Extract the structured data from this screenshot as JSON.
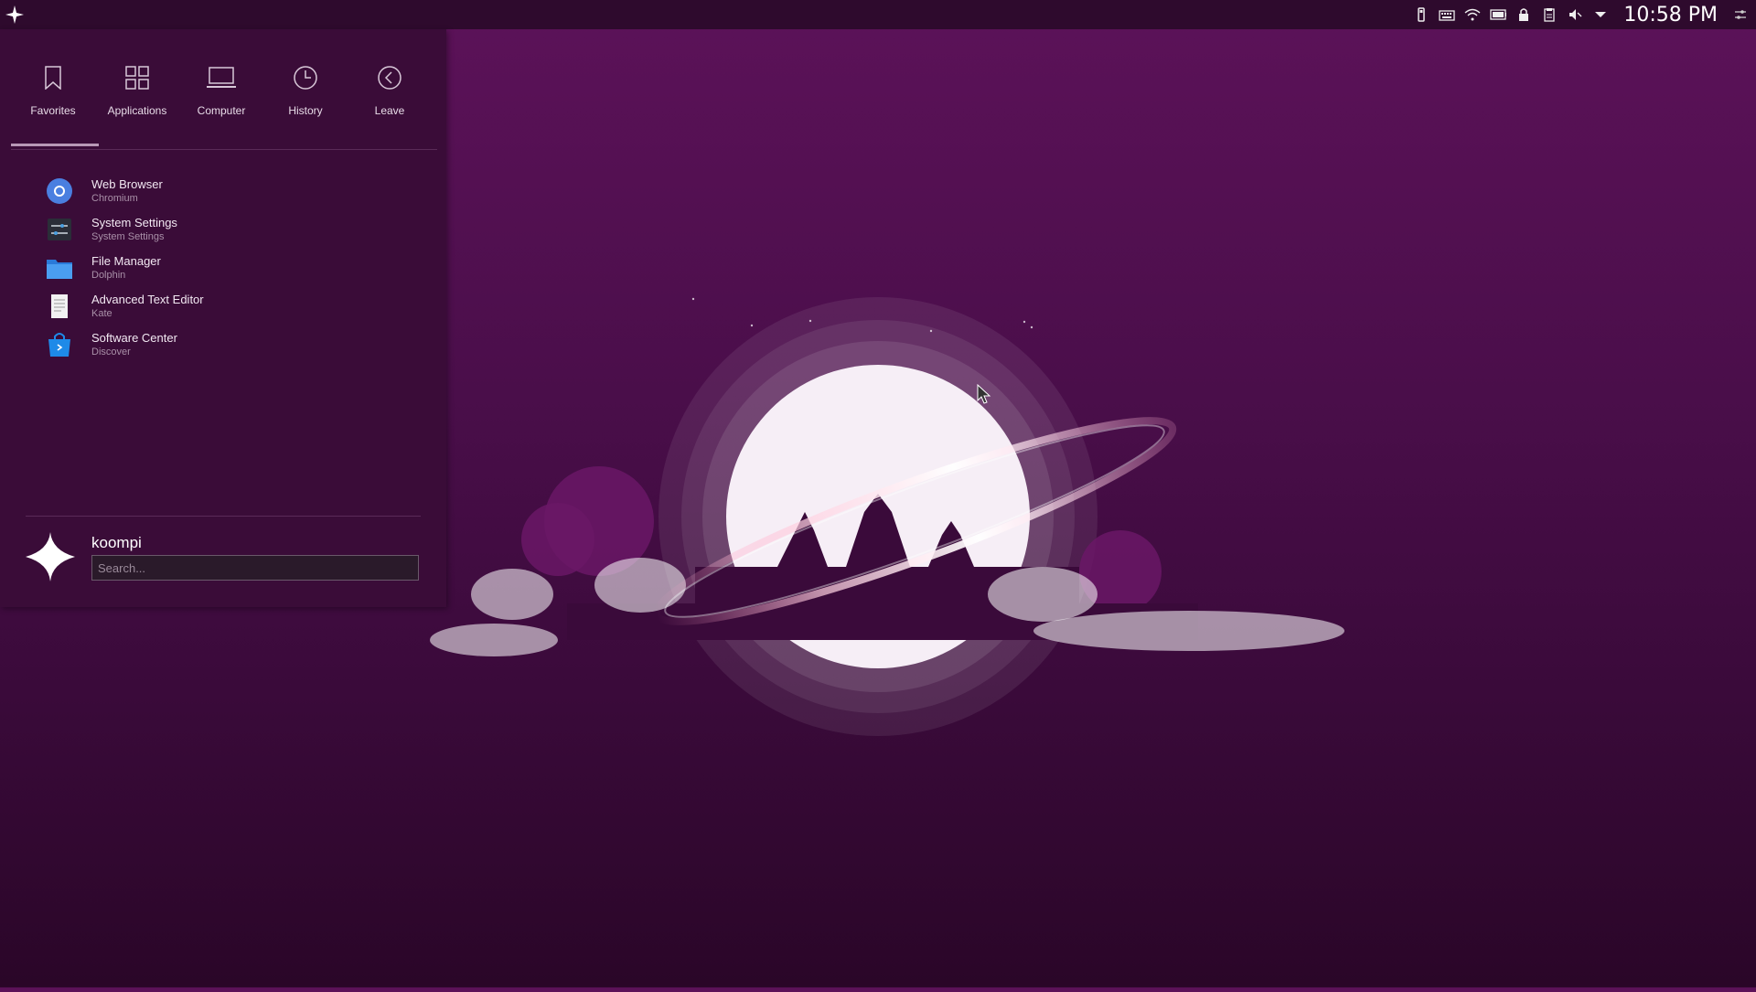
{
  "panel": {
    "launcher_icon": "koompi-logo-icon",
    "tray_icons": [
      "usb-icon",
      "keyboard-icon",
      "wifi-icon",
      "battery-icon",
      "lock-icon",
      "clipboard-icon",
      "volume-muted-icon",
      "expand-arrow-icon"
    ],
    "clock": "10:58 PM",
    "settings_icon": "panel-settings-icon"
  },
  "menu": {
    "tabs": [
      {
        "label": "Favorites",
        "icon": "bookmark-icon",
        "active": true
      },
      {
        "label": "Applications",
        "icon": "grid-icon",
        "active": false
      },
      {
        "label": "Computer",
        "icon": "laptop-icon",
        "active": false
      },
      {
        "label": "History",
        "icon": "clock-icon",
        "active": false
      },
      {
        "label": "Leave",
        "icon": "back-arrow-icon",
        "active": false
      }
    ],
    "favorites": [
      {
        "name": "Web Browser",
        "sub": "Chromium",
        "icon": "chromium-icon"
      },
      {
        "name": "System Settings",
        "sub": "System Settings",
        "icon": "settings-icon"
      },
      {
        "name": "File Manager",
        "sub": "Dolphin",
        "icon": "folder-icon"
      },
      {
        "name": "Advanced Text Editor",
        "sub": "Kate",
        "icon": "text-editor-icon"
      },
      {
        "name": "Software Center",
        "sub": "Discover",
        "icon": "store-icon"
      }
    ],
    "user": {
      "name": "koompi",
      "avatar": "koompi-logo-icon"
    },
    "search": {
      "placeholder": "Search...",
      "value": ""
    }
  },
  "colors": {
    "panel_bg": "#2e0a2d",
    "menu_bg": "#3a0c38",
    "desktop_top": "#5c1259",
    "desktop_bottom": "#2a0628"
  }
}
